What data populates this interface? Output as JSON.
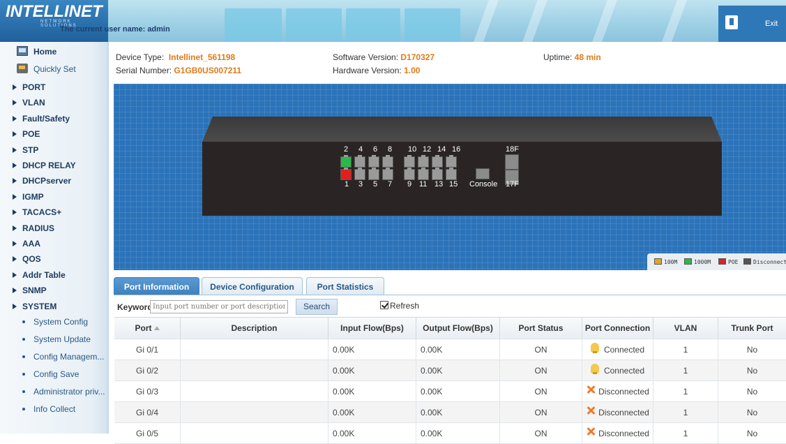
{
  "header": {
    "logo": "INTELLINET",
    "logo_sub": "NETWORK SOLUTIONS",
    "user_line": "The current user name: admin",
    "exit_label": "Exit"
  },
  "sidebar": {
    "home": "Home",
    "quickly_set": "Quickly Set",
    "items": [
      "PORT",
      "VLAN",
      "Fault/Safety",
      "POE",
      "STP",
      "DHCP RELAY",
      "DHCPserver",
      "IGMP",
      "TACACS+",
      "RADIUS",
      "AAA",
      "QOS",
      "Addr Table",
      "SNMP",
      "SYSTEM"
    ],
    "system_sub": [
      "System Config",
      "System Update",
      "Config Managem...",
      "Config Save",
      "Administrator priv...",
      "Info Collect"
    ]
  },
  "info": {
    "device_type_label": "Device Type:",
    "device_type": "Intellinet_561198",
    "serial_label": "Serial Number:",
    "serial": "G1GB0US007211",
    "sw_version_label": "Software Version:",
    "sw_version": "D170327",
    "hw_version_label": "Hardware Version:",
    "hw_version": "1.00",
    "uptime_label": "Uptime:",
    "uptime": "48 min"
  },
  "device": {
    "top_port_numbers": [
      "2",
      "4",
      "6",
      "8",
      "10",
      "12",
      "14",
      "16"
    ],
    "bottom_port_numbers": [
      "1",
      "3",
      "5",
      "7",
      "9",
      "11",
      "13",
      "15"
    ],
    "console_label": "Console",
    "sfp_top_label": "18F",
    "sfp_bottom_label": "17F",
    "legend": [
      "100M",
      "1000M",
      "POE",
      "Disconnect"
    ],
    "legend_colors": [
      "#e0a81e",
      "#2bb84a",
      "#e02020",
      "#555555"
    ]
  },
  "tabs": [
    "Port Information",
    "Device Configuration",
    "Port Statistics"
  ],
  "search": {
    "keyword_label": "Keyword",
    "placeholder": "Input port number or port description",
    "button": "Search",
    "refresh_label": "Refresh"
  },
  "table": {
    "columns": [
      "Port",
      "Description",
      "Input Flow(Bps)",
      "Output Flow(Bps)",
      "Port Status",
      "Port Connection",
      "VLAN",
      "Trunk Port"
    ],
    "rows": [
      {
        "port": "Gi 0/1",
        "desc": "",
        "in": "0.00K",
        "out": "0.00K",
        "status": "ON",
        "conn": "Connected",
        "vlan": "1",
        "trunk": "No"
      },
      {
        "port": "Gi 0/2",
        "desc": "",
        "in": "0.00K",
        "out": "0.00K",
        "status": "ON",
        "conn": "Connected",
        "vlan": "1",
        "trunk": "No"
      },
      {
        "port": "Gi 0/3",
        "desc": "",
        "in": "0.00K",
        "out": "0.00K",
        "status": "ON",
        "conn": "Disconnected",
        "vlan": "1",
        "trunk": "No"
      },
      {
        "port": "Gi 0/4",
        "desc": "",
        "in": "0.00K",
        "out": "0.00K",
        "status": "ON",
        "conn": "Disconnected",
        "vlan": "1",
        "trunk": "No"
      },
      {
        "port": "Gi 0/5",
        "desc": "",
        "in": "0.00K",
        "out": "0.00K",
        "status": "ON",
        "conn": "Disconnected",
        "vlan": "1",
        "trunk": "No"
      }
    ]
  }
}
